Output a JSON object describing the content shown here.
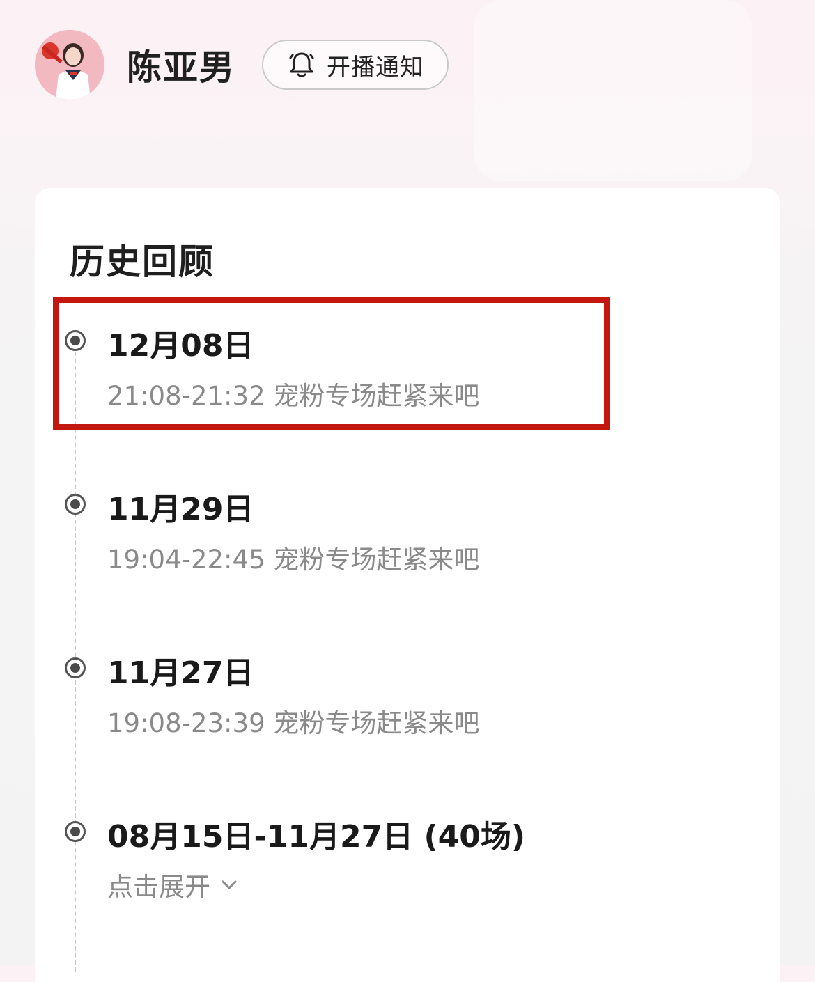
{
  "header": {
    "host_name": "陈亚男",
    "notify_label": "开播通知"
  },
  "history": {
    "title": "历史回顾",
    "items": [
      {
        "date": "12月08日",
        "desc": "21:08-21:32 宠粉专场赶紧来吧"
      },
      {
        "date": "11月29日",
        "desc": "19:04-22:45 宠粉专场赶紧来吧"
      },
      {
        "date": "11月27日",
        "desc": "19:08-23:39 宠粉专场赶紧来吧"
      }
    ],
    "group": {
      "date": "08月15日-11月27日 (40场)",
      "expand_label": "点击展开"
    }
  },
  "colors": {
    "highlight": "#c3170f",
    "muted_text": "#8a8a8a",
    "dot": "#4a4a4a"
  }
}
